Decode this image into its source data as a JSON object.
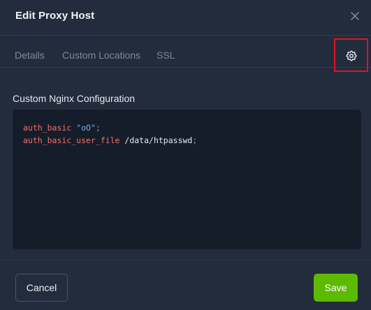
{
  "modal": {
    "title": "Edit Proxy Host",
    "close_icon": "close-icon"
  },
  "tabs": [
    {
      "label": "Details",
      "active": false
    },
    {
      "label": "Custom Locations",
      "active": false
    },
    {
      "label": "SSL",
      "active": false
    },
    {
      "label": "",
      "icon": "gear-icon",
      "active": true,
      "highlighted": true
    }
  ],
  "advanced": {
    "section_label": "Custom Nginx Configuration",
    "code_lines": [
      [
        {
          "text": "auth_basic",
          "kind": "kw"
        },
        {
          "text": " ",
          "kind": "plain"
        },
        {
          "text": "\"oO\"",
          "kind": "str"
        },
        {
          "text": ";",
          "kind": "punc"
        }
      ],
      [
        {
          "text": "auth_basic_user_file",
          "kind": "kw"
        },
        {
          "text": " /data/htpasswd",
          "kind": "plain"
        },
        {
          "text": ";",
          "kind": "punc"
        }
      ]
    ]
  },
  "footer": {
    "cancel_label": "Cancel",
    "save_label": "Save"
  },
  "colors": {
    "background": "#232c3c",
    "editor_background": "#151c2a",
    "highlight_border": "#e0141e",
    "save_button": "#5eba00",
    "keyword": "#f0726b",
    "string": "#7aa9e8"
  }
}
